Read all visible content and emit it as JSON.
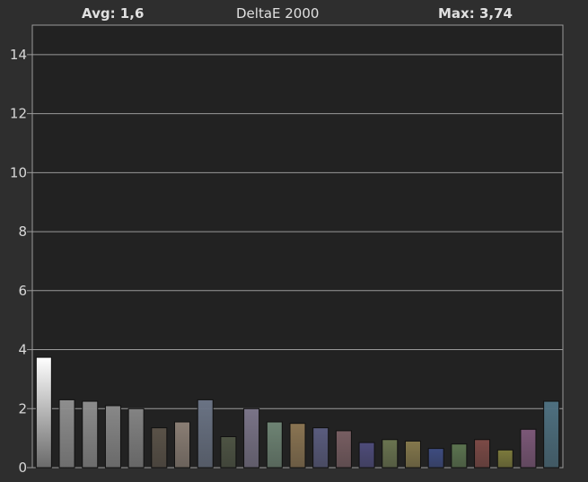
{
  "header": {
    "avg_text": "Avg: 1,6",
    "title": "DeltaE 2000",
    "max_text": "Max: 3,74"
  },
  "colors": {
    "background": "#2e2e2e",
    "plot_background": "#222222",
    "grid": "#9a9a9a",
    "text": "#d8d8d8"
  },
  "chart_data": {
    "type": "bar",
    "title": "DeltaE 2000",
    "xlabel": "",
    "ylabel": "",
    "ylim": [
      0,
      15
    ],
    "yticks": [
      0,
      2,
      4,
      6,
      8,
      10,
      12,
      14
    ],
    "ytick_labels": [
      "0",
      "2",
      "4",
      "6",
      "8",
      "10",
      "12",
      "14"
    ],
    "grid": true,
    "values": [
      3.74,
      2.3,
      2.25,
      2.1,
      2.0,
      1.35,
      1.55,
      2.3,
      1.05,
      2.0,
      1.55,
      1.5,
      1.35,
      1.25,
      0.85,
      0.95,
      0.9,
      0.65,
      0.8,
      0.95,
      0.6,
      1.3,
      2.25
    ],
    "bar_colors": [
      "#ffffff",
      "#8e8e8e",
      "#8c8c8c",
      "#888888",
      "#838383",
      "#5a5248",
      "#8a7e74",
      "#6a7384",
      "#4e5444",
      "#7a7488",
      "#6e8474",
      "#8a7452",
      "#5a5c7e",
      "#785e62",
      "#4e4c7a",
      "#6a7450",
      "#84784c",
      "#3e4c80",
      "#5c7450",
      "#7c4a46",
      "#7c7a3c",
      "#7c5878",
      "#4e7080"
    ]
  }
}
